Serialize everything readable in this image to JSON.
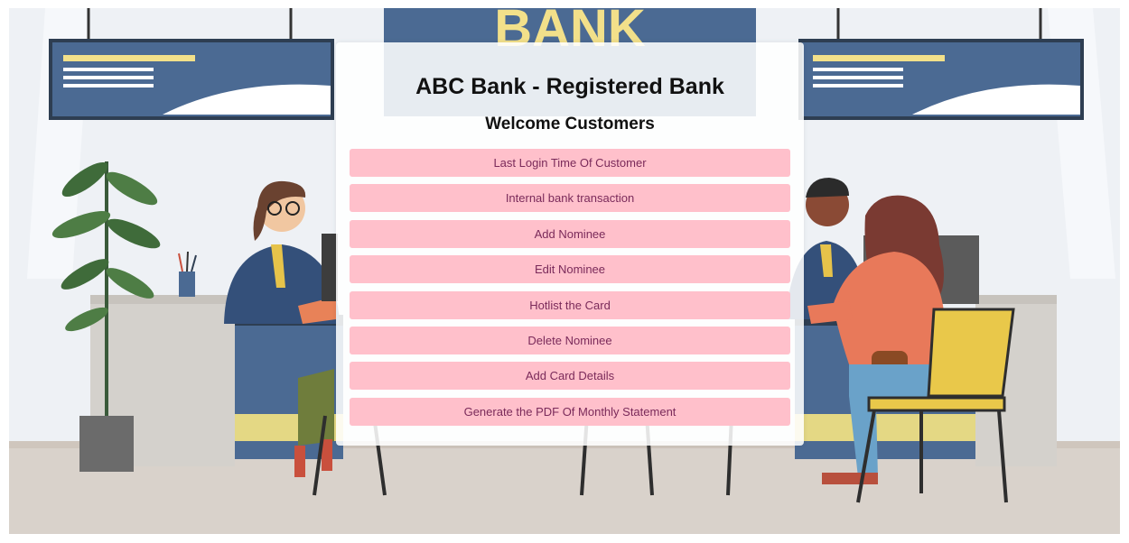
{
  "page": {
    "title": "ABC Bank - Registered Bank",
    "subtitle": "Welcome Customers"
  },
  "background": {
    "bank_sign_text": "BANK"
  },
  "menu": {
    "items": [
      {
        "name": "last-login-time-button",
        "label": "Last Login Time Of Customer"
      },
      {
        "name": "internal-bank-transaction-button",
        "label": "Internal bank transaction"
      },
      {
        "name": "add-nominee-button",
        "label": "Add Nominee"
      },
      {
        "name": "edit-nominee-button",
        "label": "Edit Nominee"
      },
      {
        "name": "hotlist-card-button",
        "label": "Hotlist the Card"
      },
      {
        "name": "delete-nominee-button",
        "label": "Delete Nominee"
      },
      {
        "name": "add-card-details-button",
        "label": "Add Card Details"
      },
      {
        "name": "generate-pdf-statement-button",
        "label": "Generate the PDF Of Monthly Statement"
      }
    ]
  },
  "colors": {
    "button_bg": "#ffc0cb",
    "button_text": "#7a2a5a",
    "sign_blue": "#4b6a93",
    "sign_yellow": "#f2e08a"
  }
}
